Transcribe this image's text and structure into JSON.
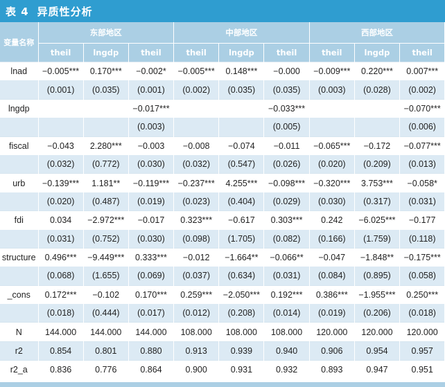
{
  "title": {
    "number": "表 4",
    "text": "异质性分析"
  },
  "header": {
    "var_label": "变量名称",
    "groups": [
      "东部地区",
      "中部地区",
      "西部地区"
    ],
    "columns": [
      "theil",
      "lngdp",
      "theil",
      "theil",
      "lngdp",
      "theil",
      "theil",
      "lngdp",
      "theil"
    ]
  },
  "rows": [
    {
      "label": "lnad",
      "kind": "coef",
      "cells": [
        "−0.005***",
        "0.170***",
        "−0.002*",
        "−0.005***",
        "0.148***",
        "−0.000",
        "−0.009***",
        "0.220***",
        "0.007***"
      ]
    },
    {
      "label": "",
      "kind": "se",
      "cells": [
        "(0.001)",
        "(0.035)",
        "(0.001)",
        "(0.002)",
        "(0.035)",
        "(0.035)",
        "(0.003)",
        "(0.028)",
        "(0.002)"
      ]
    },
    {
      "label": "lngdp",
      "kind": "coef",
      "cells": [
        "",
        "",
        "−0.017***",
        "",
        "",
        "−0.033***",
        "",
        "",
        "−0.070***"
      ]
    },
    {
      "label": "",
      "kind": "se",
      "cells": [
        "",
        "",
        "(0.003)",
        "",
        "",
        "(0.005)",
        "",
        "",
        "(0.006)"
      ]
    },
    {
      "label": "fiscal",
      "kind": "coef",
      "cells": [
        "−0.043",
        "2.280***",
        "−0.003",
        "−0.008",
        "−0.074",
        "−0.011",
        "−0.065***",
        "−0.172",
        "−0.077***"
      ]
    },
    {
      "label": "",
      "kind": "se",
      "cells": [
        "(0.032)",
        "(0.772)",
        "(0.030)",
        "(0.032)",
        "(0.547)",
        "(0.026)",
        "(0.020)",
        "(0.209)",
        "(0.013)"
      ]
    },
    {
      "label": "urb",
      "kind": "coef",
      "cells": [
        "−0.139***",
        "1.181**",
        "−0.119***",
        "−0.237***",
        "4.255***",
        "−0.098***",
        "−0.320***",
        "3.753***",
        "−0.058*"
      ]
    },
    {
      "label": "",
      "kind": "se",
      "cells": [
        "(0.020)",
        "(0.487)",
        "(0.019)",
        "(0.023)",
        "(0.404)",
        "(0.029)",
        "(0.030)",
        "(0.317)",
        "(0.031)"
      ]
    },
    {
      "label": "fdi",
      "kind": "coef",
      "cells": [
        "0.034",
        "−2.972***",
        "−0.017",
        "0.323***",
        "−0.617",
        "0.303***",
        "0.242",
        "−6.025***",
        "−0.177"
      ]
    },
    {
      "label": "",
      "kind": "se",
      "cells": [
        "(0.031)",
        "(0.752)",
        "(0.030)",
        "(0.098)",
        "(1.705)",
        "(0.082)",
        "(0.166)",
        "(1.759)",
        "(0.118)"
      ]
    },
    {
      "label": "structure",
      "kind": "coef",
      "cells": [
        "0.496***",
        "−9.449***",
        "0.333***",
        "−0.012",
        "−1.664**",
        "−0.066**",
        "−0.047",
        "−1.848**",
        "−0.175***"
      ]
    },
    {
      "label": "",
      "kind": "se",
      "cells": [
        "(0.068)",
        "(1.655)",
        "(0.069)",
        "(0.037)",
        "(0.634)",
        "(0.031)",
        "(0.084)",
        "(0.895)",
        "(0.058)"
      ]
    },
    {
      "label": "_cons",
      "kind": "coef",
      "cells": [
        "0.172***",
        "−0.102",
        "0.170***",
        "0.259***",
        "−2.050***",
        "0.192***",
        "0.386***",
        "−1.955***",
        "0.250***"
      ]
    },
    {
      "label": "",
      "kind": "se",
      "cells": [
        "(0.018)",
        "(0.444)",
        "(0.017)",
        "(0.012)",
        "(0.208)",
        "(0.014)",
        "(0.019)",
        "(0.206)",
        "(0.018)"
      ]
    },
    {
      "label": "N",
      "kind": "stat",
      "cells": [
        "144.000",
        "144.000",
        "144.000",
        "108.000",
        "108.000",
        "108.000",
        "120.000",
        "120.000",
        "120.000"
      ]
    },
    {
      "label": "r2",
      "kind": "stat alt",
      "cells": [
        "0.854",
        "0.801",
        "0.880",
        "0.913",
        "0.939",
        "0.940",
        "0.906",
        "0.954",
        "0.957"
      ]
    },
    {
      "label": "r2_a",
      "kind": "stat",
      "cells": [
        "0.836",
        "0.776",
        "0.864",
        "0.900",
        "0.931",
        "0.932",
        "0.893",
        "0.947",
        "0.951"
      ]
    }
  ]
}
